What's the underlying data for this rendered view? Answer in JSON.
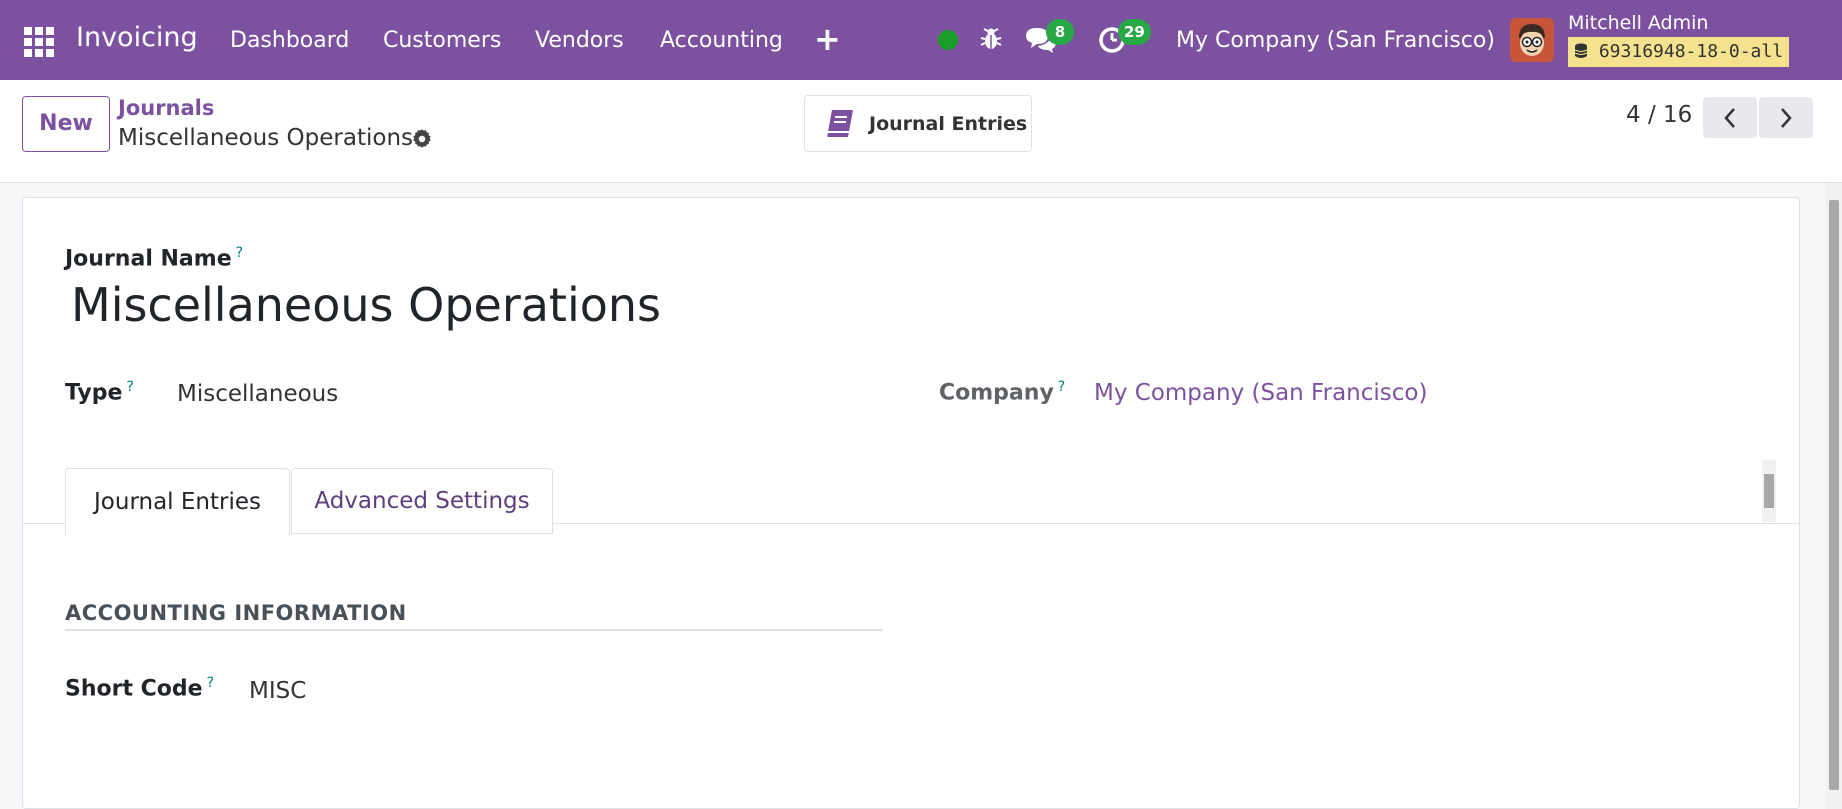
{
  "navbar": {
    "app_name": "Invoicing",
    "menu": [
      "Dashboard",
      "Customers",
      "Vendors",
      "Accounting"
    ],
    "plus_symbol": "+",
    "messages_count": "8",
    "activities_count": "29",
    "company": "My Company (San Francisco)",
    "user_name": "Mitchell Admin",
    "database": "69316948-18-0-all"
  },
  "control_panel": {
    "new_label": "New",
    "breadcrumb_parent": "Journals",
    "breadcrumb_current": "Miscellaneous Operations",
    "smart_button_label": "Journal Entries",
    "pager": "4 / 16"
  },
  "form": {
    "journal_name_label": "Journal Name",
    "journal_name": "Miscellaneous Operations",
    "type_label": "Type",
    "type_value": "Miscellaneous",
    "company_label": "Company",
    "company_value": "My Company (San Francisco)",
    "help_mark": "?",
    "tabs": [
      "Journal Entries",
      "Advanced Settings"
    ],
    "section_title": "ACCOUNTING INFORMATION",
    "short_code_label": "Short Code",
    "short_code_value": "MISC"
  },
  "colors": {
    "brand": "#7c52a0",
    "badge": "#28a745",
    "status_online": "#1a9c2a",
    "help": "#017e84"
  },
  "icons": [
    "apps-grid-icon",
    "bug-icon",
    "chat-icon",
    "clock-icon",
    "database-icon",
    "gear-icon",
    "book-icon",
    "chevron-left-icon",
    "chevron-right-icon"
  ]
}
